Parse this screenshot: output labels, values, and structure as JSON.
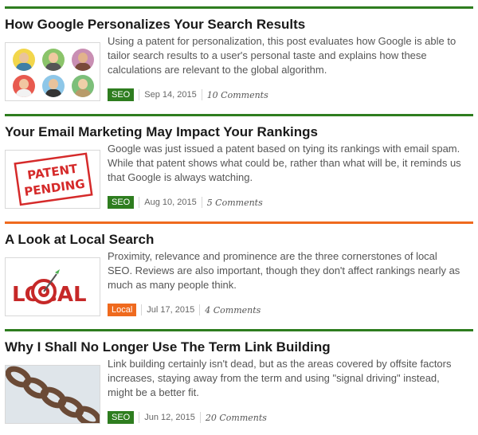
{
  "posts": [
    {
      "title": "How Google Personalizes Your Search Results",
      "excerpt": "Using a patent for personalization, this post evaluates how Google is able to tailor search results to a user's personal taste and explains how these calculations are relevant to the global algorithm.",
      "category": "SEO",
      "date": "Sep 14, 2015",
      "comments": "10 Comments",
      "thumbnail": "avatars-icon",
      "accent": "#2e7d1f"
    },
    {
      "title": "Your Email Marketing May Impact Your Rankings",
      "excerpt": "Google was just issued a patent based on tying its rankings with email spam. While that patent shows what could be, rather than what will be, it reminds us that Google is always watching.",
      "category": "SEO",
      "date": "Aug 10, 2015",
      "comments": "5 Comments",
      "thumbnail": "patent-pending-stamp",
      "thumb_text": [
        "PATENT",
        "PENDING"
      ],
      "accent": "#2e7d1f"
    },
    {
      "title": "A Look at Local Search",
      "excerpt": "Proximity, relevance and prominence are the three cornerstones of local SEO. Reviews are also important, though they don't affect rankings nearly as much as many people think.",
      "category": "Local",
      "date": "Jul 17, 2015",
      "comments": "4 Comments",
      "thumbnail": "local-target-logo",
      "thumb_text": "LOCAL",
      "accent": "#ef6a1e"
    },
    {
      "title": "Why I Shall No Longer Use The Term Link Building",
      "excerpt": "Link building certainly isn't dead, but as the areas covered by offsite factors increases, staying away from the term and using \"signal driving\" instead, might be a better fit.",
      "category": "SEO",
      "date": "Jun 12, 2015",
      "comments": "20 Comments",
      "thumbnail": "chain-icon",
      "accent": "#2e7d1f"
    }
  ]
}
